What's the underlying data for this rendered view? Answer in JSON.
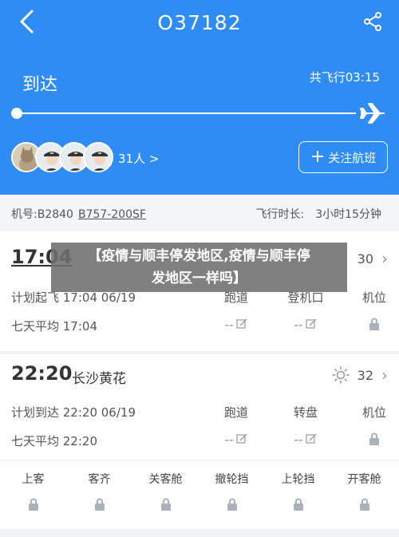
{
  "header": {
    "flight_no": "O37182",
    "status": "到达",
    "total_label": "共飞行03:15",
    "people_count": "31人 >",
    "follow_label": "关注航班"
  },
  "info": {
    "reg_label": "机号:B2840",
    "aircraft_type": "B757-200SF",
    "duration_label": "飞行时长:",
    "duration_value": "3小时15分钟"
  },
  "departure": {
    "time": "17:04",
    "temp": "30",
    "plan_label": "计划起飞 17:04 06/19",
    "avg_label": "七天平均 17:04",
    "cols": [
      "跑道",
      "登机口",
      "机位"
    ],
    "vals": [
      "--",
      "--"
    ]
  },
  "arrival": {
    "time": "22:20",
    "airport": "长沙黄花",
    "temp": "32",
    "plan_label": "计划到达 22:20 06/19",
    "avg_label": "七天平均 22:20",
    "cols": [
      "跑道",
      "转盘",
      "机位"
    ],
    "vals": [
      "--",
      "--"
    ]
  },
  "ground": [
    "上客",
    "客齐",
    "关客舱",
    "撤轮挡",
    "上轮挡",
    "开客舱"
  ],
  "overlay": {
    "line1": "【疫情与顺丰停发地区,疫情与顺丰停",
    "line2": "发地区一样吗】"
  },
  "colors": {
    "primary": "#2f8cf4",
    "bg": "#f0f2f6",
    "lock": "#a9b1bb"
  }
}
